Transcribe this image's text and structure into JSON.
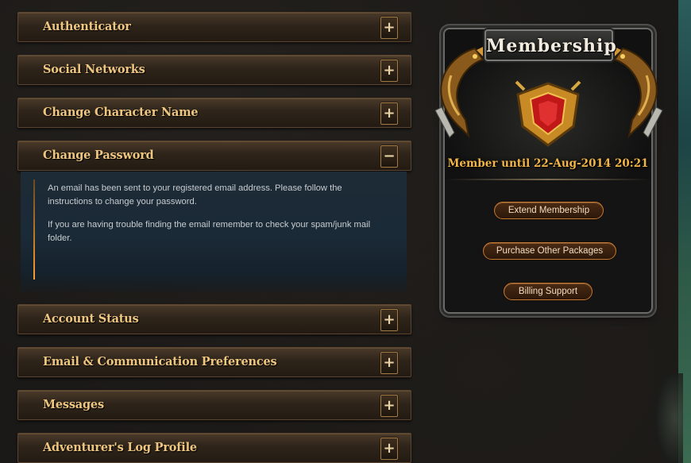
{
  "accordion": {
    "sections": [
      {
        "label": "Authenticator",
        "toggle": "+"
      },
      {
        "label": "Social Networks",
        "toggle": "+"
      },
      {
        "label": "Change Character Name",
        "toggle": "+"
      },
      {
        "label": "Change Password",
        "toggle": "−"
      },
      {
        "label": "Account Status",
        "toggle": "+"
      },
      {
        "label": "Email & Communication Preferences",
        "toggle": "+"
      },
      {
        "label": "Messages",
        "toggle": "+"
      },
      {
        "label": "Adventurer's Log Profile",
        "toggle": "+"
      }
    ],
    "open_panel": {
      "paragraphs": [
        "An email has been sent to your registered email address. Please follow the instructions to change your password.",
        "If you are having trouble finding the email remember to check your spam/junk mail folder."
      ]
    }
  },
  "membership": {
    "title": "Membership",
    "member_until": "Member until 22-Aug-2014 20:21",
    "buttons": {
      "extend": "Extend Membership",
      "purchase": "Purchase Other Packages",
      "billing": "Billing Support"
    }
  },
  "colors": {
    "header_text": "#efc680",
    "member_until": "#f3b646",
    "button_border": "#c07a36"
  },
  "icons": {
    "expand": "plus-icon",
    "collapse": "minus-icon",
    "crest": "shield-crest-icon",
    "dragon": "dragon-ornament-icon"
  }
}
